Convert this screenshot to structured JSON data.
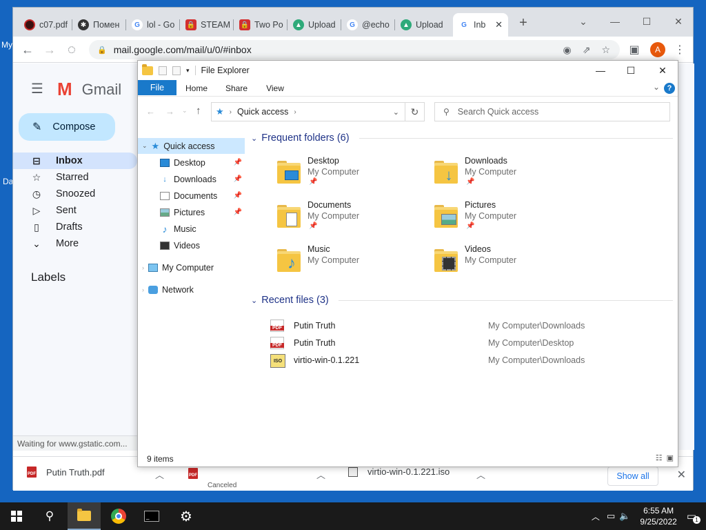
{
  "desktop": {
    "label_my": "My",
    "label_da": "Da"
  },
  "browser": {
    "tabs": [
      {
        "label": "c07.pdf",
        "icon": "dark-circle-icon"
      },
      {
        "label": "Помен",
        "icon": "spider-icon"
      },
      {
        "label": "lol - Go",
        "icon": "google-icon"
      },
      {
        "label": "STEAM",
        "icon": "lock-icon"
      },
      {
        "label": "Two Po",
        "icon": "lock-icon"
      },
      {
        "label": "Upload",
        "icon": "upload-icon"
      },
      {
        "label": "@echo",
        "icon": "google-icon"
      },
      {
        "label": "Upload",
        "icon": "upload-icon"
      },
      {
        "label": "Inb",
        "icon": "google-icon",
        "active": true
      }
    ],
    "url": "mail.google.com/mail/u/0/#inbox",
    "avatar_letter": "A"
  },
  "gmail": {
    "logo_text": "Gmail",
    "compose_label": "Compose",
    "nav": [
      {
        "label": "Inbox",
        "icon": "inbox-icon"
      },
      {
        "label": "Starred",
        "icon": "star-icon"
      },
      {
        "label": "Snoozed",
        "icon": "clock-icon"
      },
      {
        "label": "Sent",
        "icon": "send-icon"
      },
      {
        "label": "Drafts",
        "icon": "draft-icon"
      },
      {
        "label": "More",
        "icon": "chevron-down-icon"
      }
    ],
    "labels_heading": "Labels",
    "status": "Waiting for www.gstatic.com..."
  },
  "downloads": {
    "items": [
      {
        "name": "Putin Truth.pdf",
        "sub": ""
      },
      {
        "name": "",
        "sub": "Canceled"
      },
      {
        "name": "virtio-win-0.1.221.iso",
        "sub": ""
      }
    ],
    "show_all": "Show all"
  },
  "explorer": {
    "title": "File Explorer",
    "ribbon_tabs": [
      "File",
      "Home",
      "Share",
      "View"
    ],
    "address": "Quick access",
    "search_placeholder": "Search Quick access",
    "nav": {
      "quick_access": "Quick access",
      "items": [
        "Desktop",
        "Downloads",
        "Documents",
        "Pictures",
        "Music",
        "Videos"
      ],
      "my_computer": "My Computer",
      "network": "Network"
    },
    "frequent_heading": "Frequent folders (6)",
    "folders": [
      {
        "name": "Desktop",
        "location": "My Computer",
        "pinned": true
      },
      {
        "name": "Downloads",
        "location": "My Computer",
        "pinned": true
      },
      {
        "name": "Documents",
        "location": "My Computer",
        "pinned": true
      },
      {
        "name": "Pictures",
        "location": "My Computer",
        "pinned": true
      },
      {
        "name": "Music",
        "location": "My Computer",
        "pinned": false
      },
      {
        "name": "Videos",
        "location": "My Computer",
        "pinned": false
      }
    ],
    "recent_heading": "Recent files (3)",
    "recent": [
      {
        "name": "Putin Truth",
        "path": "My Computer\\Downloads",
        "type": "pdf"
      },
      {
        "name": "Putin Truth",
        "path": "My Computer\\Desktop",
        "type": "pdf"
      },
      {
        "name": "virtio-win-0.1.221",
        "path": "My Computer\\Downloads",
        "type": "iso"
      }
    ],
    "status": "9 items"
  },
  "taskbar": {
    "time": "6:55 AM",
    "date": "9/25/2022",
    "notification_count": "1"
  },
  "colors": {
    "desktop": "#1565c0",
    "accent": "#1979ca",
    "gmail_active": "#d3e3fd",
    "compose": "#c2e7ff"
  }
}
